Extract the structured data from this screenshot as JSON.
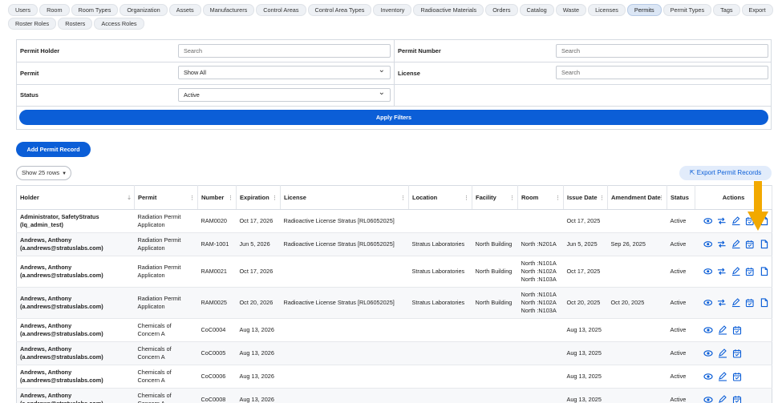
{
  "tabs": [
    {
      "label": "Users",
      "active": false
    },
    {
      "label": "Room",
      "active": false
    },
    {
      "label": "Room Types",
      "active": false
    },
    {
      "label": "Organization",
      "active": false
    },
    {
      "label": "Assets",
      "active": false
    },
    {
      "label": "Manufacturers",
      "active": false
    },
    {
      "label": "Control Areas",
      "active": false
    },
    {
      "label": "Control Area Types",
      "active": false
    },
    {
      "label": "Inventory",
      "active": false
    },
    {
      "label": "Radioactive Materials",
      "active": false
    },
    {
      "label": "Orders",
      "active": false
    },
    {
      "label": "Catalog",
      "active": false
    },
    {
      "label": "Waste",
      "active": false
    },
    {
      "label": "Licenses",
      "active": false
    },
    {
      "label": "Permits",
      "active": true
    },
    {
      "label": "Permit Types",
      "active": false
    },
    {
      "label": "Tags",
      "active": false
    },
    {
      "label": "Export",
      "active": false
    },
    {
      "label": "Roster Roles",
      "active": false
    },
    {
      "label": "Rosters",
      "active": false
    },
    {
      "label": "Access Roles",
      "active": false
    }
  ],
  "filters": {
    "permit_holder_label": "Permit Holder",
    "permit_holder_placeholder": "Search",
    "permit_number_label": "Permit Number",
    "permit_number_placeholder": "Search",
    "permit_label": "Permit",
    "permit_value": "Show All",
    "license_label": "License",
    "license_placeholder": "Search",
    "status_label": "Status",
    "status_value": "Active",
    "apply_label": "Apply Filters"
  },
  "actions": {
    "add_label": "Add Permit Record",
    "rows_label": "Show 25 rows",
    "export_label": "Export Permit Records"
  },
  "columns": [
    "Holder",
    "Permit",
    "Number",
    "Expiration",
    "License",
    "Location",
    "Facility",
    "Room",
    "Issue Date",
    "Amendment Date",
    "Status",
    "Actions"
  ],
  "rows": [
    {
      "holder": "Administrator, SafetyStratus (lq_admin_test)",
      "permit": "Radiation Permit Applicaton",
      "number": "RAM0020",
      "expiration": "Oct 17, 2026",
      "license": "Radioactive License Stratus [RL06052025]",
      "location": "",
      "facility": "",
      "room": "",
      "issue": "Oct 17, 2025",
      "amendment": "",
      "status": "Active",
      "icons": [
        "view",
        "transfer",
        "edit",
        "calendar",
        "document"
      ]
    },
    {
      "holder": "Andrews, Anthony (a.andrews@stratuslabs.com)",
      "permit": "Radiation Permit Applicaton",
      "number": "RAM-1001",
      "expiration": "Jun 5, 2026",
      "license": "Radioactive License Stratus [RL06052025]",
      "location": "Stratus Laboratories",
      "facility": "North Building",
      "room": "North :N201A",
      "issue": "Jun 5, 2025",
      "amendment": "Sep 26, 2025",
      "status": "Active",
      "icons": [
        "view",
        "transfer",
        "edit",
        "calendar",
        "document"
      ]
    },
    {
      "holder": "Andrews, Anthony (a.andrews@stratuslabs.com)",
      "permit": "Radiation Permit Applicaton",
      "number": "RAM0021",
      "expiration": "Oct 17, 2026",
      "license": "",
      "location": "Stratus Laboratories",
      "facility": "North Building",
      "room": "North :N101A\nNorth :N102A\nNorth :N103A",
      "issue": "Oct 17, 2025",
      "amendment": "",
      "status": "Active",
      "icons": [
        "view",
        "transfer",
        "edit",
        "calendar",
        "document"
      ]
    },
    {
      "holder": "Andrews, Anthony (a.andrews@stratuslabs.com)",
      "permit": "Radiation Permit Applicaton",
      "number": "RAM0025",
      "expiration": "Oct 20, 2026",
      "license": "Radioactive License Stratus [RL06052025]",
      "location": "Stratus Laboratories",
      "facility": "North Building",
      "room": "North :N101A\nNorth :N102A\nNorth :N103A",
      "issue": "Oct 20, 2025",
      "amendment": "Oct 20, 2025",
      "status": "Active",
      "icons": [
        "view",
        "transfer",
        "edit",
        "calendar",
        "document"
      ]
    },
    {
      "holder": "Andrews, Anthony (a.andrews@stratuslabs.com)",
      "permit": "Chemicals of Concern A",
      "number": "CoC0004",
      "expiration": "Aug 13, 2026",
      "license": "",
      "location": "",
      "facility": "",
      "room": "",
      "issue": "Aug 13, 2025",
      "amendment": "",
      "status": "Active",
      "icons": [
        "view",
        "edit",
        "calendar"
      ]
    },
    {
      "holder": "Andrews, Anthony (a.andrews@stratuslabs.com)",
      "permit": "Chemicals of Concern A",
      "number": "CoC0005",
      "expiration": "Aug 13, 2026",
      "license": "",
      "location": "",
      "facility": "",
      "room": "",
      "issue": "Aug 13, 2025",
      "amendment": "",
      "status": "Active",
      "icons": [
        "view",
        "edit",
        "calendar"
      ]
    },
    {
      "holder": "Andrews, Anthony (a.andrews@stratuslabs.com)",
      "permit": "Chemicals of Concern A",
      "number": "CoC0006",
      "expiration": "Aug 13, 2026",
      "license": "",
      "location": "",
      "facility": "",
      "room": "",
      "issue": "Aug 13, 2025",
      "amendment": "",
      "status": "Active",
      "icons": [
        "view",
        "edit",
        "calendar"
      ]
    },
    {
      "holder": "Andrews, Anthony (a.andrews@stratuslabs.com)",
      "permit": "Chemicals of Concern A",
      "number": "CoC0008",
      "expiration": "Aug 13, 2026",
      "license": "",
      "location": "",
      "facility": "",
      "room": "",
      "issue": "Aug 13, 2025",
      "amendment": "",
      "status": "Active",
      "icons": [
        "view",
        "edit",
        "calendar"
      ]
    }
  ],
  "colors": {
    "primary": "#0b5ed7",
    "arrow": "#f2a900"
  }
}
